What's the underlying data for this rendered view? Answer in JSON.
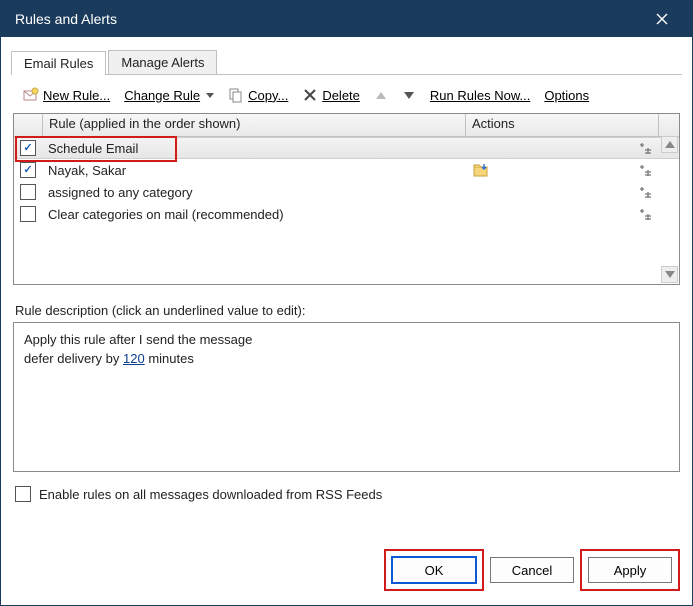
{
  "title": "Rules and Alerts",
  "tabs": {
    "email_rules": "Email Rules",
    "manage_alerts": "Manage Alerts"
  },
  "toolbar": {
    "new_rule": "New Rule...",
    "change_rule": "Change Rule",
    "copy": "Copy...",
    "delete": "Delete",
    "run_rules": "Run Rules Now...",
    "options": "Options"
  },
  "headers": {
    "rule": "Rule (applied in the order shown)",
    "actions": "Actions"
  },
  "rules": [
    {
      "checked": true,
      "name": "Schedule Email",
      "has_folder": false,
      "has_gear": true
    },
    {
      "checked": true,
      "name": "Nayak, Sakar",
      "has_folder": true,
      "has_gear": true
    },
    {
      "checked": false,
      "name": "assigned to any category",
      "has_folder": false,
      "has_gear": true
    },
    {
      "checked": false,
      "name": "Clear categories on mail (recommended)",
      "has_folder": false,
      "has_gear": true
    }
  ],
  "desc_label": "Rule description (click an underlined value to edit):",
  "desc": {
    "line1": "Apply this rule after I send the message",
    "line2a": "defer delivery by ",
    "line2_link": "120",
    "line2b": " minutes"
  },
  "rss_label": "Enable rules on all messages downloaded from RSS Feeds",
  "buttons": {
    "ok": "OK",
    "cancel": "Cancel",
    "apply": "Apply"
  }
}
